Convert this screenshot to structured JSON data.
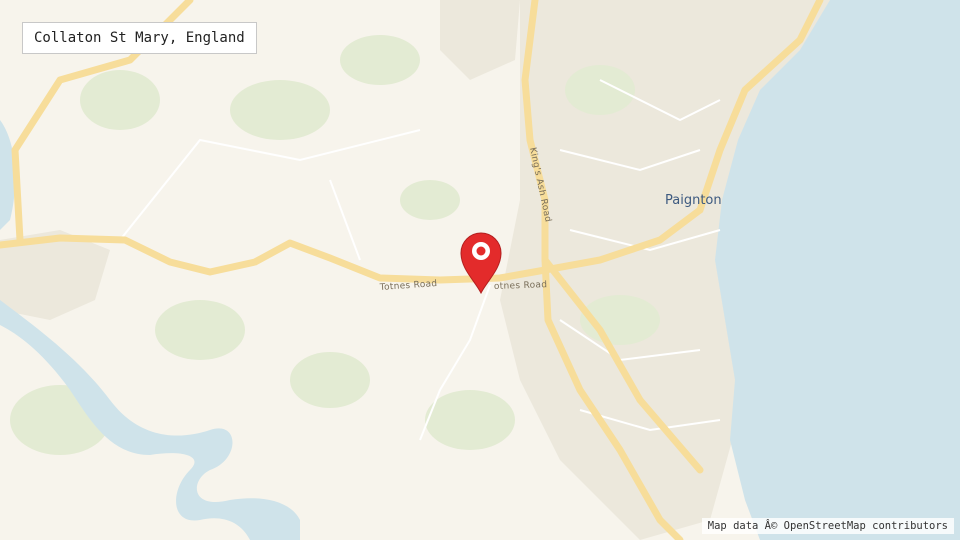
{
  "search": {
    "value": "Collaton St Mary, England"
  },
  "map": {
    "colors": {
      "land": "#f7f4ec",
      "water": "#cfe3ea",
      "park": "#e3ebd3",
      "urban": "#ece8dc",
      "major_road": "#f7dd9a",
      "minor_road": "#ffffff",
      "marker": "#e32b2b"
    },
    "labels": {
      "road_totnes_west": "Totnes Road",
      "road_totnes_east": "otnes Road",
      "road_kings_ash": "King's Ash Road",
      "town_paignton": "Paignton"
    },
    "marker_icon": "map-pin-icon",
    "attribution": "Map data Â© OpenStreetMap contributors"
  }
}
